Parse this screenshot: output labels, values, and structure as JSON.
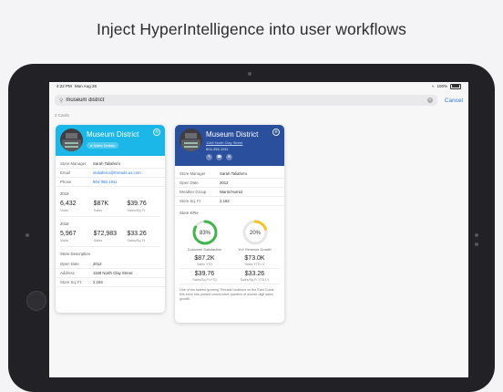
{
  "headline": "Inject HyperIntelligence into user workflows",
  "status": {
    "time": "4:22 PM",
    "date": "Mon Aug 26",
    "battery": "100%"
  },
  "search": {
    "query": "museum district",
    "cancel": "Cancel"
  },
  "card_count": "2 Cards",
  "card1": {
    "title": "Museum District",
    "pill": "Sales Details",
    "rows": [
      {
        "k": "Store Manager",
        "v": "Sarah Taliaferro"
      },
      {
        "k": "Email",
        "v": "staliaferro@threads.us.com"
      },
      {
        "k": "Phone",
        "v": "804-355-1911"
      }
    ],
    "year1": "2019",
    "m1": [
      {
        "num": "6,432",
        "lbl": "Visits"
      },
      {
        "num": "$87K",
        "lbl": "Sales"
      },
      {
        "num": "$39.76",
        "lbl": "Sales/Sq Ft"
      }
    ],
    "year2": "2018",
    "m2": [
      {
        "num": "5,967",
        "lbl": "Visits"
      },
      {
        "num": "$72,983",
        "lbl": "Sales"
      },
      {
        "num": "$33.26",
        "lbl": "Sales/Sq Ft"
      }
    ],
    "desc_title": "Store Description",
    "rows2": [
      {
        "k": "Open Date",
        "v": "2012"
      },
      {
        "k": "Address",
        "v": "1168 North Clay Street"
      },
      {
        "k": "Store Sq. Ft",
        "v": "2,184"
      }
    ]
  },
  "card2": {
    "title": "Museum District",
    "address": "1168 North Clay Street",
    "phone": "804-355-1911",
    "rows": [
      {
        "k": "Store Manager",
        "v": "Sarah Taliaferro"
      },
      {
        "k": "Open Date",
        "v": "2012"
      },
      {
        "k": "Weather Group",
        "v": "Warm/Humid"
      },
      {
        "k": "Store Sq. Ft",
        "v": "2,184"
      }
    ],
    "kpi_title": "Store KPIs",
    "gauges": [
      {
        "value": "83%",
        "fraction": 0.83,
        "label": "Customer Satisfaction",
        "color": "#3fb54a"
      },
      {
        "value": "20%",
        "fraction": 0.2,
        "label": "YoY Revenue Growth",
        "color": "#f3c623"
      }
    ],
    "kpis": [
      {
        "num": "$87.2K",
        "lbl": "Sales YTD"
      },
      {
        "num": "$73.0K",
        "lbl": "Sales YTD LY"
      },
      {
        "num": "$39.76",
        "lbl": "Sales/Sq Ft YTD"
      },
      {
        "num": "$33.26",
        "lbl": "Sales/Sq Ft YTD LY"
      }
    ],
    "description": "One of the fastest growing Threads locations on the East Coast, this store has posted consecutive quarters of double-digit sales growth."
  },
  "colors": {
    "card1_header": "#1ab7e8",
    "card2_header": "#2a4f9c",
    "link": "#2e7be6"
  }
}
